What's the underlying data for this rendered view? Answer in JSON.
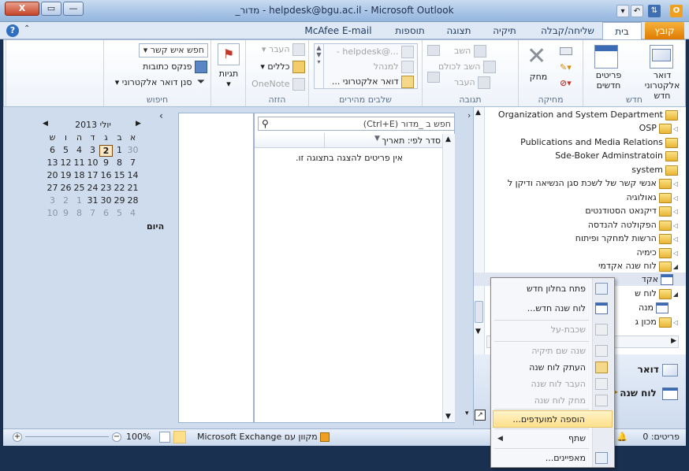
{
  "window": {
    "title": "_מדור - helpdesk@bgu.ac.il - Microsoft Outlook",
    "close": "X",
    "max": "▭",
    "min": "—"
  },
  "tabs": [
    {
      "label": "קובץ"
    },
    {
      "label": "בית"
    },
    {
      "label": "שליחה/קבלה"
    },
    {
      "label": "תיקיה"
    },
    {
      "label": "תצוגה"
    },
    {
      "label": "תוספות"
    },
    {
      "label": "McAfee E-mail Scan"
    }
  ],
  "ribbon": {
    "new": {
      "label": "חדש",
      "new_email": "דואר אלקטרוני חדש",
      "new_items": "פריטים חדשים"
    },
    "delete": {
      "label": "מחיקה",
      "delete_btn": "מחק"
    },
    "respond": {
      "label": "תגובה",
      "reply": "השב",
      "reply_all": "השב לכולם",
      "forward": "העבר"
    },
    "quick_steps": {
      "label": "שלבים מהירים",
      "item1": "...@helpdesk -",
      "item2": "למנהל",
      "item3": "דואר אלקטרוני ..."
    },
    "move": {
      "label": "הזזה",
      "move_btn": "העבר",
      "rules": "כללים",
      "onenote": "OneNote"
    },
    "tags": {
      "label": "תגיות",
      "tags_btn": "תגיות"
    },
    "find": {
      "label": "חיפוש",
      "find_contact": "חפש איש קשר",
      "address_book": "פנקס כתובות",
      "filter_email": "סנן דואר אלקטרוני"
    }
  },
  "folders": [
    {
      "name": "Organization and System Department"
    },
    {
      "name": "OSP"
    },
    {
      "name": "Publications and Media Relations"
    },
    {
      "name": "Sde-Boker Adminstratoin"
    },
    {
      "name": "system"
    },
    {
      "name": "אנשי קשר  של לשכת סגן הנשיאה ודיקן ל"
    },
    {
      "name": "גאולוגיה"
    },
    {
      "name": "דיקנאט הסטודנטים"
    },
    {
      "name": "הפקולטה להנדסה"
    },
    {
      "name": "הרשות למחקר ופיתוח"
    },
    {
      "name": "כימיה"
    },
    {
      "name": "לוח שנה אקדמי"
    },
    {
      "name": "אקד"
    },
    {
      "name": "לוח ש"
    },
    {
      "name": "מנה"
    },
    {
      "name": "מכון ג"
    }
  ],
  "nav_bottom": {
    "mail": "דואר",
    "calendar": "לוח שנה"
  },
  "list": {
    "search_placeholder": "חפש ב _מדור (Ctrl+E)",
    "arrange_by": "סדר לפי: תאריך",
    "empty_msg": "אין פריטים להצגה בתצוגה זו."
  },
  "todo": {
    "month": "יולי 2013",
    "weekdays": [
      "א",
      "ב",
      "ג",
      "ד",
      "ה",
      "ו",
      "ש"
    ],
    "weeks": [
      [
        "30",
        "1",
        "2",
        "3",
        "4",
        "5",
        "6"
      ],
      [
        "7",
        "8",
        "9",
        "10",
        "11",
        "12",
        "13"
      ],
      [
        "14",
        "15",
        "16",
        "17",
        "18",
        "19",
        "20"
      ],
      [
        "21",
        "22",
        "23",
        "24",
        "25",
        "26",
        "27"
      ],
      [
        "28",
        "29",
        "30",
        "31",
        "1",
        "2",
        "3"
      ],
      [
        "4",
        "5",
        "6",
        "7",
        "8",
        "9",
        "10"
      ]
    ],
    "today": "היום"
  },
  "status": {
    "items": "פריטים: 0",
    "exchange": "מקוון עם Microsoft Exchange",
    "zoom": "100%"
  },
  "context_menu": [
    {
      "label": "פתח בחלון חדש",
      "disabled": false
    },
    {
      "label": "לוח שנה חדש...",
      "disabled": false
    },
    {
      "label": "שכבת-על",
      "disabled": true
    },
    {
      "label": "שנה שם תיקיה",
      "disabled": true
    },
    {
      "label": "העתק לוח שנה",
      "disabled": false
    },
    {
      "label": "העבר לוח שנה",
      "disabled": true
    },
    {
      "label": "מחק לוח שנה",
      "disabled": true
    },
    {
      "label": "הוספה למועדפים...",
      "disabled": false
    },
    {
      "label": "שתף",
      "disabled": false
    },
    {
      "label": "מאפיינים...",
      "disabled": false
    }
  ],
  "colors": {
    "file_tab": "#e07b00",
    "accent": "#1e3a5f",
    "menu_hot": "#ffe08a"
  }
}
